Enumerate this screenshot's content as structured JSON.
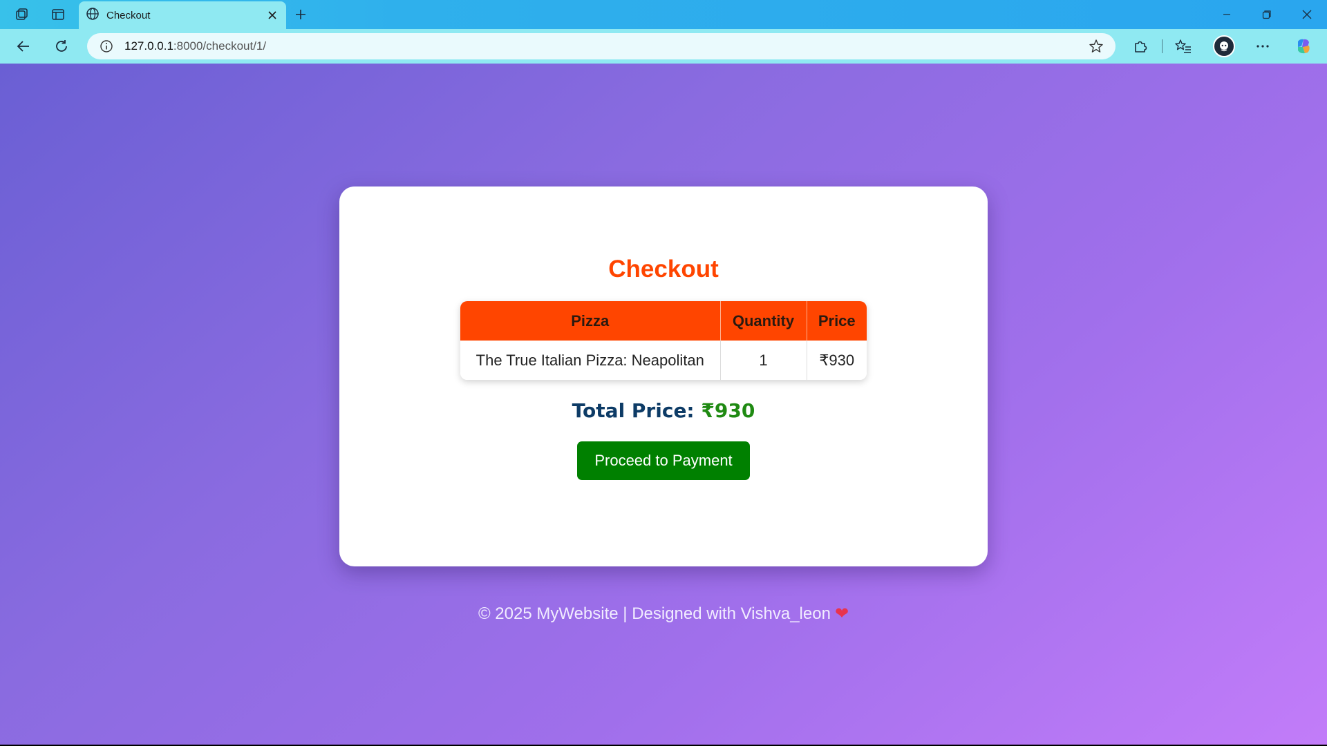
{
  "browser": {
    "tab_title": "Checkout",
    "url_host": "127.0.0.1",
    "url_rest": ":8000/checkout/1/",
    "icons": {
      "workspaces": "workspaces-icon",
      "tab_actions": "tab-actions-icon",
      "tab_favicon": "globe-icon",
      "tab_close": "close-icon",
      "new_tab": "plus-icon",
      "minimize": "minimize-icon",
      "restore": "restore-icon",
      "close_window": "close-icon",
      "back": "back-arrow-icon",
      "refresh": "refresh-icon",
      "site_info": "info-icon",
      "favorite": "star-icon",
      "extensions": "puzzle-icon",
      "favorites": "favorites-icon",
      "profile": "avatar",
      "more": "more-icon",
      "copilot": "copilot-icon"
    }
  },
  "checkout": {
    "title": "Checkout",
    "table": {
      "headers": [
        "Pizza",
        "Quantity",
        "Price"
      ],
      "rows": [
        {
          "pizza": "The True Italian Pizza: Neapolitan",
          "quantity": "1",
          "price": "₹930"
        }
      ]
    },
    "total_label": "Total Price:",
    "total_amount": "₹930",
    "button_label": "Proceed to Payment"
  },
  "footer": {
    "text": "© 2025 MyWebsite | Designed with Vishva_leon",
    "heart": "❤"
  },
  "colors": {
    "accent": "#ff4500",
    "button": "#008000",
    "total_label": "#0d3b66",
    "total_amount": "#1f8a12"
  }
}
